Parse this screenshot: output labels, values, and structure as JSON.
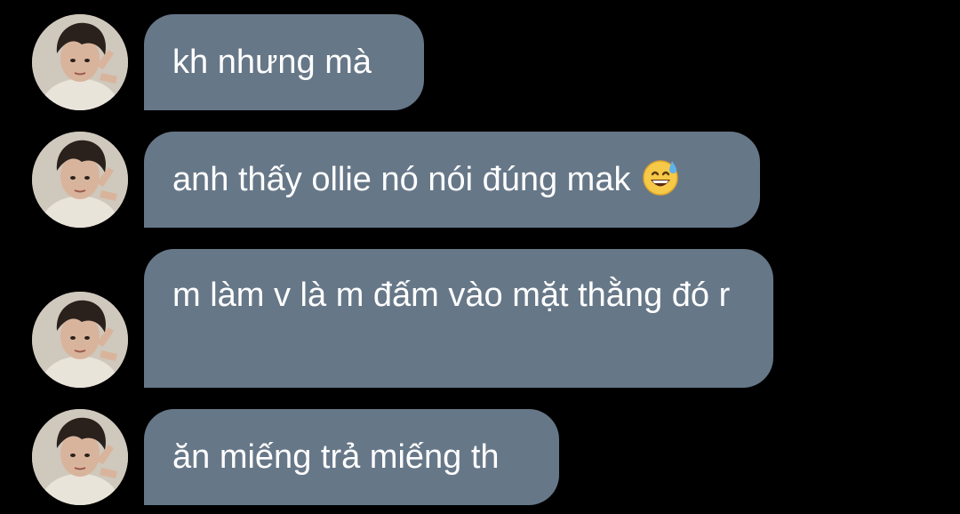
{
  "colors": {
    "background": "#000000",
    "bubble": "#667788",
    "bubble_text": "#ffffff"
  },
  "messages": [
    {
      "text": "kh nhưng mà",
      "emoji": null
    },
    {
      "text": "anh thấy ollie nó nói đúng mak",
      "emoji": "grinning-face-with-sweat-icon"
    },
    {
      "text": "m làm v là m đấm vào mặt thằng đó r",
      "emoji": null
    },
    {
      "text": "ăn miếng trả miếng th",
      "emoji": null
    }
  ]
}
